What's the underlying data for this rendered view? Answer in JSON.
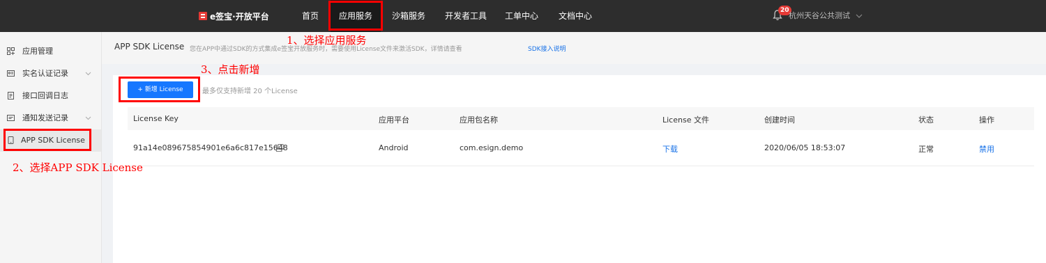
{
  "brand": {
    "name": "e签宝·开放平台",
    "color": "#e53935"
  },
  "nav": [
    {
      "label": "首页"
    },
    {
      "label": "应用服务"
    },
    {
      "label": "沙箱服务"
    },
    {
      "label": "开发者工具"
    },
    {
      "label": "工单中心"
    },
    {
      "label": "文档中心"
    }
  ],
  "notifications": {
    "count": "20",
    "icon": "bell-icon"
  },
  "user": {
    "name": "杭州天谷公共测试"
  },
  "sidebar": {
    "items": [
      {
        "label": "应用管理",
        "icon": "grid-icon"
      },
      {
        "label": "实名认证记录",
        "icon": "id-card-icon",
        "expandable": true
      },
      {
        "label": "接口回调日志",
        "icon": "document-icon"
      },
      {
        "label": "通知发送记录",
        "icon": "message-icon",
        "expandable": true
      },
      {
        "label": "APP SDK License",
        "icon": "phone-icon",
        "selected": true
      }
    ]
  },
  "page": {
    "title": "APP SDK License",
    "description": "您在APP中通过SDK的方式集成e签宝开放服务时，需要使用License文件来激活SDK，详情请查看",
    "link": "SDK接入说明"
  },
  "toolbar": {
    "add_label": "+ 新增 License",
    "hint": "最多仅支持新增 20 个License"
  },
  "table": {
    "columns": [
      "License Key",
      "应用平台",
      "应用包名称",
      "License 文件",
      "创建时间",
      "状态",
      "操作"
    ],
    "rows": [
      {
        "key": "91a14e089675854901e6a6c817e15648",
        "platform": "Android",
        "package": "com.esign.demo",
        "file": "下载",
        "created": "2020/06/05 18:53:07",
        "status": "正常",
        "action": "禁用"
      }
    ]
  },
  "annotations": {
    "step1": "1、选择应用服务",
    "step2": "2、选择APP SDK License",
    "step3": "3、点击新增"
  },
  "colors": {
    "annotation": "#ff0000",
    "primary": "#1677ff",
    "link": "#1a73e8",
    "topbar": "#2d2d2d"
  }
}
